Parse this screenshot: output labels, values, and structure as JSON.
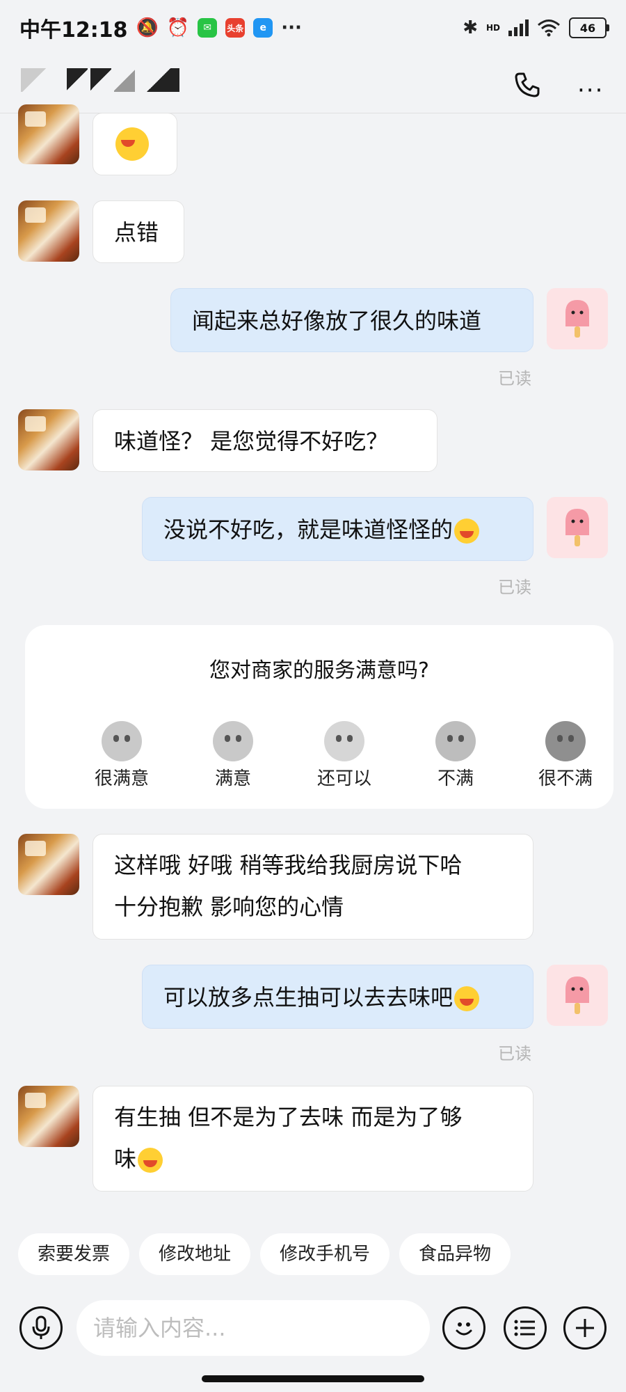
{
  "status_bar": {
    "time": "中午12:18",
    "app_badges": [
      {
        "name": "wechat",
        "text": "",
        "color": "#28c445"
      },
      {
        "name": "toutiao",
        "text": "头条",
        "color": "#e8402f"
      },
      {
        "name": "browser",
        "text": "e",
        "color": "#2196f3"
      }
    ],
    "network": "HD",
    "battery": "46"
  },
  "header": {
    "title_masked": true
  },
  "messages": [
    {
      "side": "left",
      "text": "",
      "has_emoji": true
    },
    {
      "side": "left",
      "text": "点错"
    },
    {
      "side": "right",
      "text": "闻起来总好像放了很久的味道",
      "read": "已读"
    },
    {
      "side": "left",
      "text": "味道怪？ 是您觉得不好吃？"
    },
    {
      "side": "right",
      "text": "没说不好吃，就是味道怪怪的",
      "has_emoji": true,
      "read": "已读"
    },
    {
      "side": "left",
      "lines": [
        "这样哦  好哦 稍等我给我厨房说下哈",
        "十分抱歉 影响您的心情"
      ]
    },
    {
      "side": "right",
      "text": "可以放多点生抽可以去去味吧",
      "has_emoji": true,
      "read": "已读"
    },
    {
      "side": "left",
      "lines": [
        "有生抽 但不是为了去味 而是为了够",
        "味"
      ],
      "has_emoji": true
    }
  ],
  "survey": {
    "question": "您对商家的服务满意吗?",
    "options": [
      "很满意",
      "满意",
      "还可以",
      "不满",
      "很不满"
    ]
  },
  "quick_replies": [
    "索要发票",
    "修改地址",
    "修改手机号",
    "食品异物"
  ],
  "input": {
    "placeholder": "请输入内容..."
  }
}
